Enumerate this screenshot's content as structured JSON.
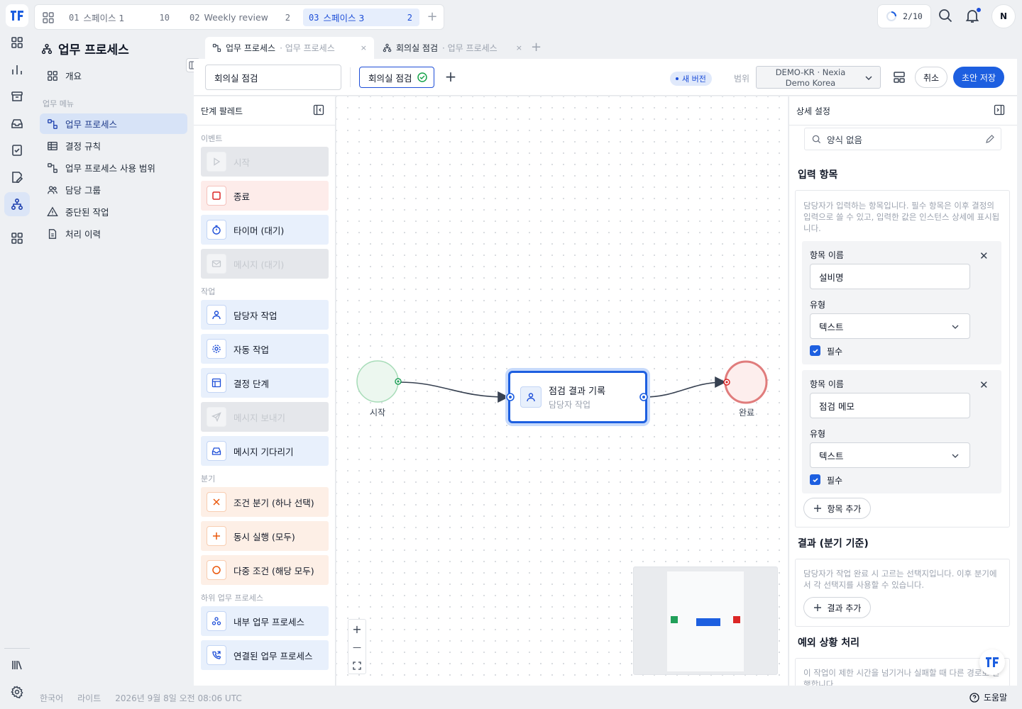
{
  "workspace_bar": {
    "tabs": [
      {
        "num": "01",
        "name": "스페이스 1",
        "count": "10"
      },
      {
        "num": "02",
        "name": "Weekly review",
        "count": "2"
      },
      {
        "num": "03",
        "name": "스페이스 3",
        "count": "2"
      }
    ],
    "add_label": "+"
  },
  "top_right": {
    "progress": "2/10",
    "avatar": "N"
  },
  "sidebar": {
    "section_title": "업무 프로세스",
    "overview": "개요",
    "group_label": "업무 메뉴",
    "items": [
      {
        "label": "업무 프로세스"
      },
      {
        "label": "결정 규칙"
      },
      {
        "label": "업무 프로세스 사용 범위"
      },
      {
        "label": "담당 그룹"
      },
      {
        "label": "중단된 작업"
      },
      {
        "label": "처리 이력"
      }
    ]
  },
  "editor_tabs": [
    {
      "title": "업무 프로세스",
      "sub": "· 업무 프로세스",
      "close": "×"
    },
    {
      "title": "회의실 점검",
      "sub": "· 업무 프로세스",
      "close": "×"
    }
  ],
  "editor_tab_add": "+",
  "toolbar": {
    "name_value": "회의실 점검",
    "chip_label": "회의실 점검",
    "add": "+",
    "badge": "새 버전",
    "scope_label": "범위",
    "scope_line1": "DEMO-KR · Nexia",
    "scope_line2": "Demo Korea",
    "cancel": "취소",
    "save": "초안 저장"
  },
  "palette": {
    "title": "단계 팔레트",
    "groups": {
      "events": "이벤트",
      "tasks": "작업",
      "branch": "분기",
      "sub": "하위 업무 프로세스"
    },
    "items": {
      "start": "시작",
      "end": "종료",
      "timer": "타이머 (대기)",
      "msg_wait": "메시지 (대기)",
      "user_task": "담당자 작업",
      "auto_task": "자동 작업",
      "decision": "결정 단계",
      "send_msg": "메시지 보내기",
      "wait_msg": "메시지 기다리기",
      "xor": "조건 분기 (하나 선택)",
      "parallel": "동시 실행 (모두)",
      "inclusive": "다중 조건 (해당 모두)",
      "internal": "내부 업무 프로세스",
      "linked": "연결된 업무 프로세스"
    }
  },
  "canvas": {
    "start_label": "시작",
    "end_label": "완료",
    "task_title": "점검 결과 기록",
    "task_sub": "담당자 작업",
    "zoom_in": "+",
    "zoom_out": "—"
  },
  "detail": {
    "title": "상세 설정",
    "form_placeholder": "양식 없음",
    "inputs_title": "입력 항목",
    "inputs_desc": "담당자가 입력하는 항목입니다. 필수 항목은 이후 결정의 입력으로 쓸 수 있고, 입력한 값은 인스턴스 상세에 표시됩니다.",
    "field_name_label": "항목 이름",
    "type_label": "유형",
    "required_label": "필수",
    "fields": [
      {
        "name": "설비명",
        "type": "텍스트"
      },
      {
        "name": "점검 메모",
        "type": "텍스트"
      }
    ],
    "add_field": "항목 추가",
    "results_title": "결과 (분기 기준)",
    "results_desc": "담당자가 작업 완료 시 고르는 선택지입니다. 이후 분기에서 각 선택지를 사용할 수 있습니다.",
    "add_result": "결과 추가",
    "exception_title": "예외 상황 처리",
    "exception_desc": "이 작업이 제한 시간을 넘기거나 실패할 때 다른 경로로 진행합니다."
  },
  "footer": {
    "lang": "한국어",
    "theme": "라이트",
    "datetime": "2026년 9월 8일 오전 08:06 UTC",
    "help": "도움말"
  },
  "colors": {
    "primary": "#1d5fe0",
    "start_node": "#22a05a",
    "end_node": "#dc2626"
  }
}
